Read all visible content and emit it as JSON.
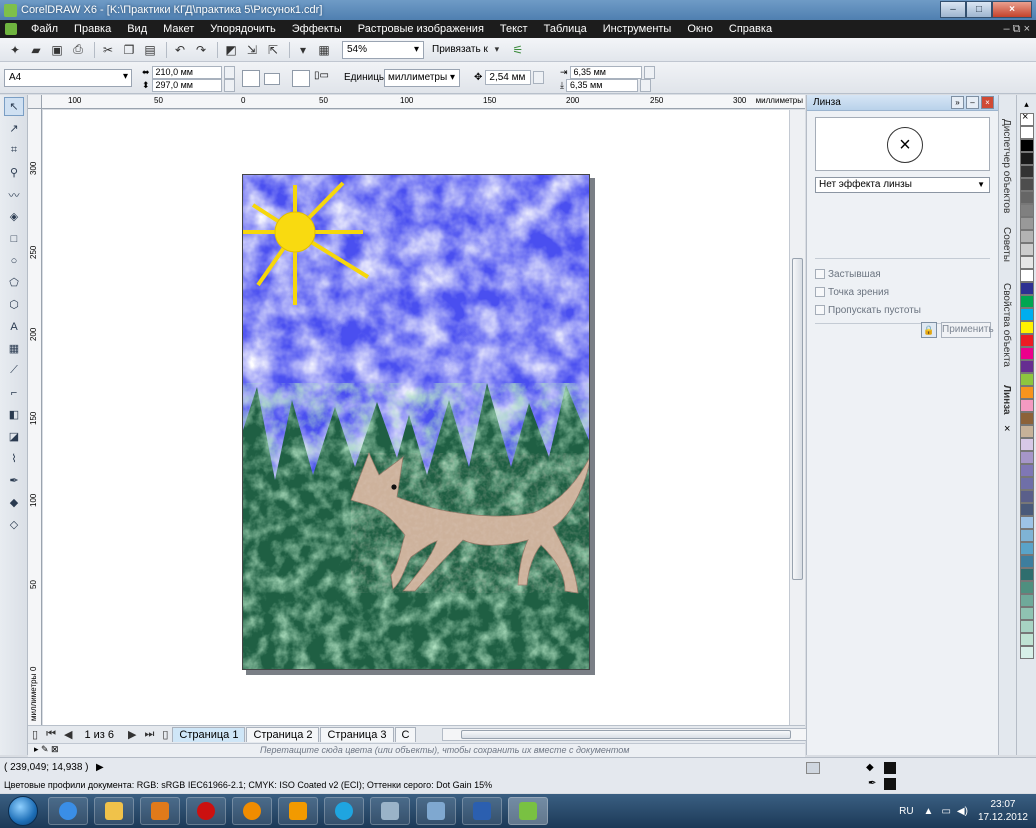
{
  "window": {
    "title": "CorelDRAW X6 - [K:\\Практики КГД\\практика 5\\Рисунок1.cdr]"
  },
  "menu": {
    "items": [
      "Файл",
      "Правка",
      "Вид",
      "Макет",
      "Упорядочить",
      "Эффекты",
      "Растровые изображения",
      "Текст",
      "Таблица",
      "Инструменты",
      "Окно",
      "Справка"
    ],
    "right_controls": "– ⧉ ×"
  },
  "toolbar": {
    "zoom_value": "54%",
    "snap_label": "Привязать к"
  },
  "property_bar": {
    "page_size": "A4",
    "width": "210,0 мм",
    "height": "297,0 мм",
    "units_label": "Единицы:",
    "units_value": "миллиметры",
    "nudge": "2,54 мм",
    "dup_x": "6,35 мм",
    "dup_y": "6,35 мм"
  },
  "ruler": {
    "h_labels": [
      "100",
      "50",
      "0",
      "50",
      "100",
      "150",
      "200",
      "250",
      "300"
    ],
    "h_unit": "миллиметры",
    "v_labels": [
      "300",
      "250",
      "200",
      "150",
      "100",
      "50",
      "0"
    ],
    "v_unit": "миллиметры"
  },
  "pages": {
    "counter": "1 из 6",
    "tabs": [
      "Страница 1",
      "Страница 2",
      "Страница 3",
      "С"
    ]
  },
  "doc_palette_hint": "Перетащите сюда цвета (или объекты), чтобы сохранить их вместе с документом",
  "docker": {
    "title": "Линза",
    "lens_mode": "Нет эффекта линзы",
    "options": [
      "Застывшая",
      "Точка зрения",
      "Пропускать пустоты"
    ],
    "apply_label": "Применить"
  },
  "docker_tabs": [
    "Диспетчер объектов",
    "Советы",
    "Свойства объекта",
    "Линза"
  ],
  "palette_colors": [
    "#ffffff",
    "#000000",
    "#1a1a1a",
    "#333333",
    "#4d4d4d",
    "#666666",
    "#808080",
    "#999999",
    "#b3b3b3",
    "#cccccc",
    "#e6e6e6",
    "#ffffff",
    "#2e3192",
    "#00a651",
    "#00aeef",
    "#fff200",
    "#ed1c24",
    "#ec008c",
    "#662d91",
    "#8dc63f",
    "#f7941d",
    "#f49ac1",
    "#8c6239",
    "#c7b299",
    "#d7c8e6",
    "#a696c8",
    "#7f77b5",
    "#6f6fa8",
    "#5a5f8a",
    "#4a5a7a",
    "#9dc3e6",
    "#7fb3d5",
    "#5aa3c8",
    "#3e7e9e",
    "#2f6e6e",
    "#4f8f7f",
    "#6fa99a",
    "#8fc3b2",
    "#a7d3c3",
    "#bfe3d3",
    "#d7f0e8"
  ],
  "status": {
    "coords": "( 239,049; 14,938 )",
    "profiles": "Цветовые профили документа: RGB: sRGB IEC61966-2.1; CMYK: ISO Coated v2 (ECI); Оттенки серого: Dot Gain 15%"
  },
  "taskbar": {
    "lang": "RU",
    "time": "23:07",
    "date": "17.12.2012",
    "apps": [
      "explorer",
      "ie",
      "files",
      "media",
      "opera",
      "avast",
      "shape",
      "skype",
      "photo",
      "calc",
      "word",
      "corel"
    ]
  }
}
